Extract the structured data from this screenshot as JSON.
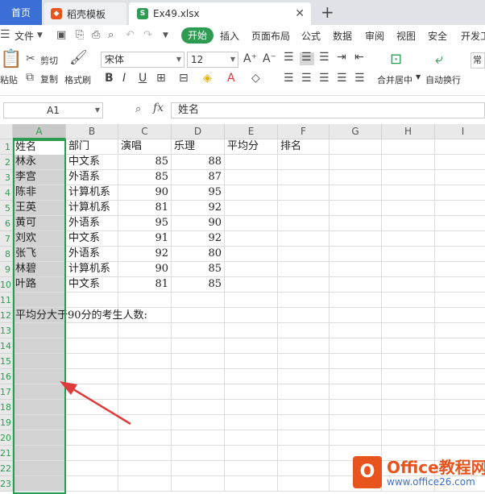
{
  "tabs": [
    {
      "label": "首页"
    },
    {
      "label": "稻壳模板"
    },
    {
      "label": "Ex49.xlsx"
    }
  ],
  "menu": {
    "file": "文件",
    "start": "开始",
    "items": [
      "插入",
      "页面布局",
      "公式",
      "数据",
      "审阅",
      "视图",
      "安全",
      "开发工"
    ]
  },
  "ribbon": {
    "paste": "粘贴",
    "cut": "剪切",
    "copy": "复制",
    "format_painter": "格式刷",
    "font_name": "宋体",
    "font_size": "12",
    "merge_center": "合并居中",
    "wrap_text": "自动换行",
    "normal": "常"
  },
  "formula_bar": {
    "name_box": "A1",
    "fx": "fx",
    "content": "姓名"
  },
  "columns": [
    "A",
    "B",
    "C",
    "D",
    "E",
    "F",
    "G",
    "H",
    "I"
  ],
  "rows": [
    "1",
    "2",
    "3",
    "4",
    "5",
    "6",
    "7",
    "8",
    "9",
    "10",
    "11",
    "12",
    "13",
    "14",
    "15",
    "16",
    "17",
    "18",
    "19",
    "20",
    "21",
    "22",
    "23"
  ],
  "table": {
    "headers": [
      "姓名",
      "部门",
      "演唱",
      "乐理",
      "平均分",
      "排名"
    ],
    "rows": [
      [
        "林永",
        "中文系",
        "85",
        "88"
      ],
      [
        "李宫",
        "外语系",
        "85",
        "87"
      ],
      [
        "陈非",
        "计算机系",
        "90",
        "95"
      ],
      [
        "王英",
        "计算机系",
        "81",
        "92"
      ],
      [
        "黄可",
        "外语系",
        "95",
        "90"
      ],
      [
        "刘欢",
        "中文系",
        "91",
        "92"
      ],
      [
        "张飞",
        "外语系",
        "92",
        "80"
      ],
      [
        "林碧",
        "计算机系",
        "90",
        "85"
      ],
      [
        "叶路",
        "中文系",
        "81",
        "85"
      ]
    ]
  },
  "note": "平均分大于90分的考生人数:",
  "watermark": {
    "logo": "O",
    "title": "Office教程网",
    "url": "www.office26.com"
  },
  "colors": {
    "accent": "#2e9b52",
    "home_tab": "#3b6fd8",
    "arrow": "#e03b3b",
    "watermark": "#e8541e"
  }
}
